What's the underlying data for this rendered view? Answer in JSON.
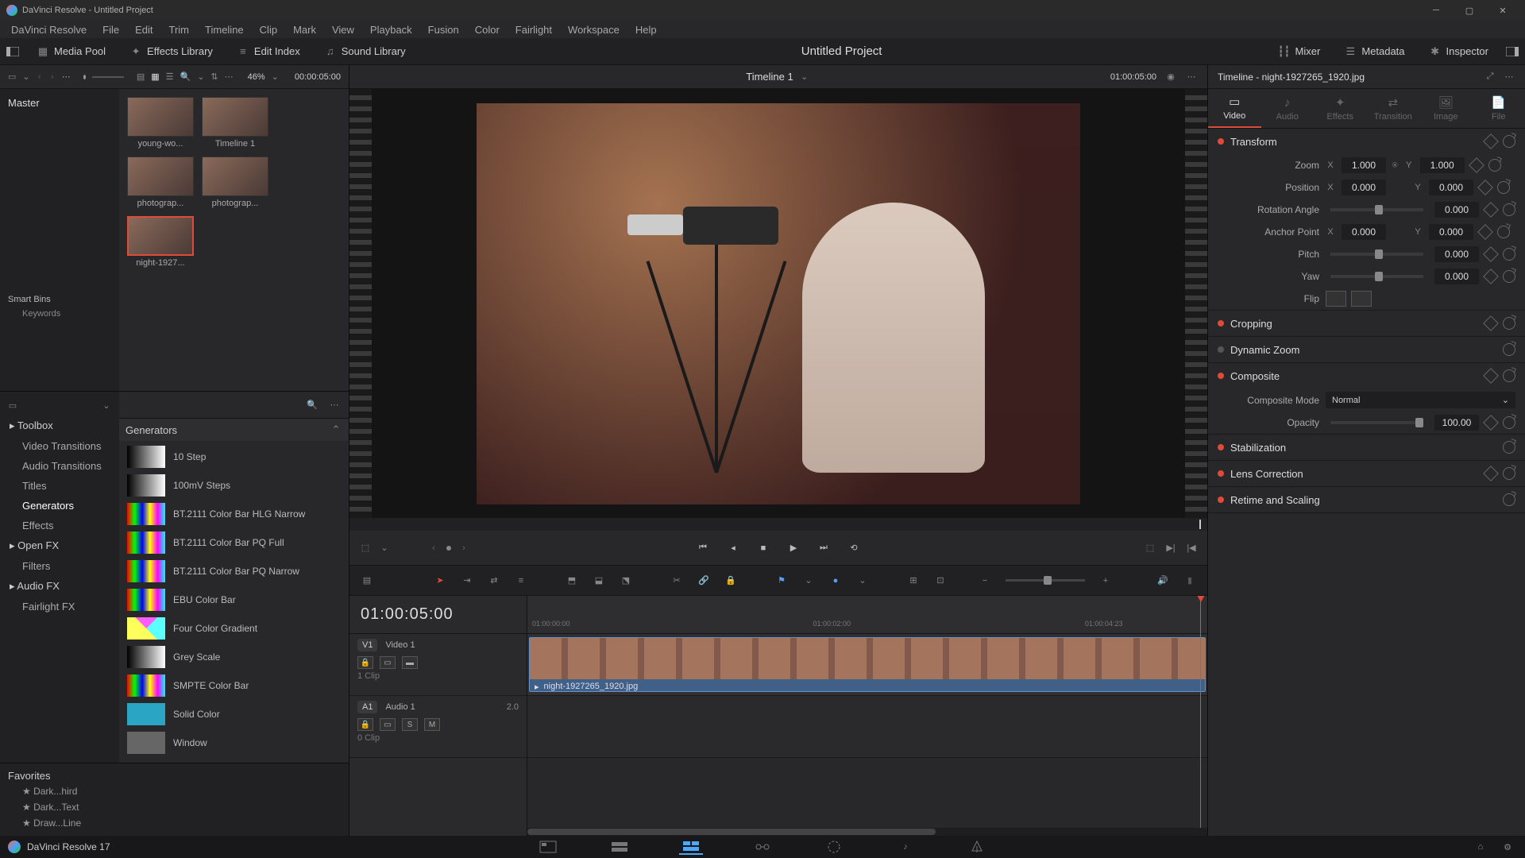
{
  "window_title": "DaVinci Resolve - Untitled Project",
  "menus": [
    "DaVinci Resolve",
    "File",
    "Edit",
    "Trim",
    "Timeline",
    "Clip",
    "Mark",
    "View",
    "Playback",
    "Fusion",
    "Color",
    "Fairlight",
    "Workspace",
    "Help"
  ],
  "toolbar": {
    "media_pool": "Media Pool",
    "effects_library": "Effects Library",
    "edit_index": "Edit Index",
    "sound_library": "Sound Library",
    "mixer": "Mixer",
    "metadata": "Metadata",
    "inspector": "Inspector"
  },
  "project_title": "Untitled Project",
  "pool_header": {
    "zoom": "46%",
    "tc": "00:00:05:00"
  },
  "viewer": {
    "title": "Timeline 1",
    "tc": "01:00:05:00"
  },
  "master": "Master",
  "smart_bins": "Smart Bins",
  "keywords": "Keywords",
  "thumbs": [
    {
      "label": "young-wo..."
    },
    {
      "label": "Timeline 1"
    },
    {
      "label": "photograp..."
    },
    {
      "label": "photograp..."
    },
    {
      "label": "night-1927...",
      "selected": true
    }
  ],
  "fx_tree": [
    {
      "label": "Toolbox",
      "type": "head"
    },
    {
      "label": "Video Transitions",
      "type": "sub"
    },
    {
      "label": "Audio Transitions",
      "type": "sub"
    },
    {
      "label": "Titles",
      "type": "sub"
    },
    {
      "label": "Generators",
      "type": "sub",
      "selected": true
    },
    {
      "label": "Effects",
      "type": "sub"
    },
    {
      "label": "Open FX",
      "type": "head"
    },
    {
      "label": "Filters",
      "type": "sub"
    },
    {
      "label": "Audio FX",
      "type": "head"
    },
    {
      "label": "Fairlight FX",
      "type": "sub"
    }
  ],
  "favorites_title": "Favorites",
  "favorites": [
    "Dark...hird",
    "Dark...Text",
    "Draw...Line"
  ],
  "fx_group": "Generators",
  "fx_items": [
    {
      "name": "10 Step",
      "cls": "fx-gray"
    },
    {
      "name": "100mV Steps",
      "cls": "fx-gray"
    },
    {
      "name": "BT.2111 Color Bar HLG Narrow",
      "cls": "fx-bar"
    },
    {
      "name": "BT.2111 Color Bar PQ Full",
      "cls": "fx-bar"
    },
    {
      "name": "BT.2111 Color Bar PQ Narrow",
      "cls": "fx-bar"
    },
    {
      "name": "EBU Color Bar",
      "cls": "fx-bar"
    },
    {
      "name": "Four Color Gradient",
      "cls": "fx-four"
    },
    {
      "name": "Grey Scale",
      "cls": "fx-gray"
    },
    {
      "name": "SMPTE Color Bar",
      "cls": "fx-bar"
    },
    {
      "name": "Solid Color",
      "cls": "fx-solid"
    },
    {
      "name": "Window",
      "cls": ""
    }
  ],
  "timeline_tc": "01:00:05:00",
  "ruler_ticks": [
    "01:00:00:00",
    "01:00:02:00",
    "01:00:04:23"
  ],
  "tracks": {
    "v1": {
      "badge": "V1",
      "name": "Video 1",
      "clips": "1 Clip"
    },
    "a1": {
      "badge": "A1",
      "name": "Audio 1",
      "ch": "2.0",
      "clips": "0 Clip"
    }
  },
  "clip_name": "night-1927265_1920.jpg",
  "inspector_title": "Timeline - night-1927265_1920.jpg",
  "insp_tabs": [
    "Video",
    "Audio",
    "Effects",
    "Transition",
    "Image",
    "File"
  ],
  "transform": {
    "title": "Transform",
    "zoom": "Zoom",
    "zoom_x": "1.000",
    "zoom_y": "1.000",
    "position": "Position",
    "pos_x": "0.000",
    "pos_y": "0.000",
    "rotation": "Rotation Angle",
    "rot_v": "0.000",
    "anchor": "Anchor Point",
    "anc_x": "0.000",
    "anc_y": "0.000",
    "pitch": "Pitch",
    "pitch_v": "0.000",
    "yaw": "Yaw",
    "yaw_v": "0.000",
    "flip": "Flip"
  },
  "cropping": "Cropping",
  "dynamic_zoom": "Dynamic Zoom",
  "composite": {
    "title": "Composite",
    "mode_lbl": "Composite Mode",
    "mode_val": "Normal",
    "opacity_lbl": "Opacity",
    "opacity_val": "100.00"
  },
  "stabilization": "Stabilization",
  "lens": "Lens Correction",
  "retime": "Retime and Scaling",
  "footer_app": "DaVinci Resolve 17"
}
